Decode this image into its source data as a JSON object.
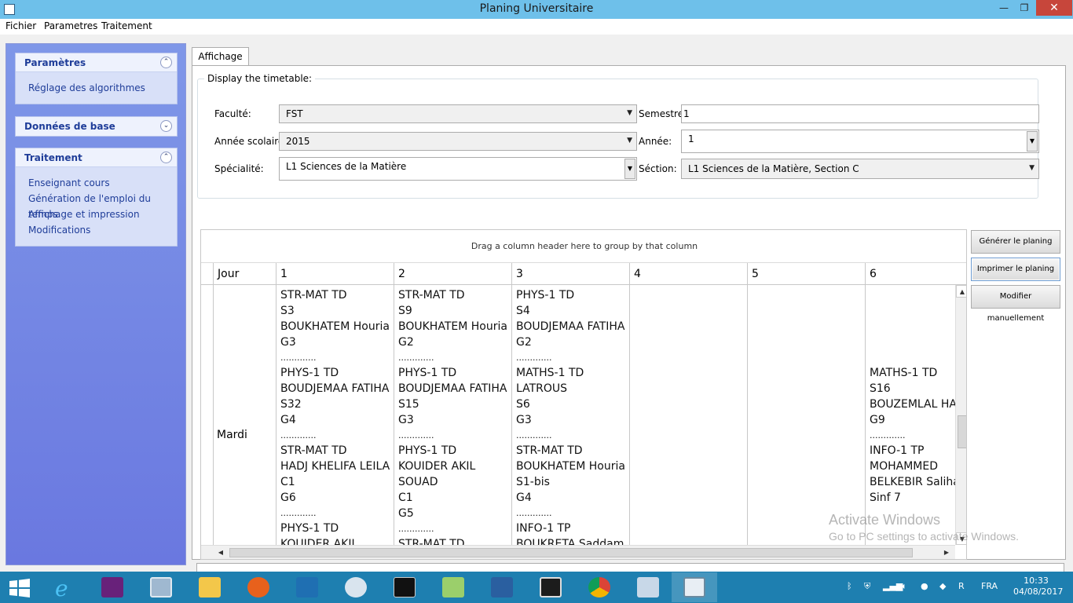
{
  "window": {
    "title": "Planing Universitaire",
    "minimize": "—",
    "maximize": "❐",
    "close": "✕"
  },
  "menu": [
    "Fichier",
    "Parametres",
    "Traitement"
  ],
  "sidebar": {
    "groups": [
      {
        "title": "Paramètres",
        "chevron": "⌃",
        "items": [
          "Réglage des algorithmes"
        ]
      },
      {
        "title": "Données de base",
        "chevron": "⌄",
        "items": []
      },
      {
        "title": "Traitement",
        "chevron": "⌃",
        "items": [
          "Enseignant cours",
          "Génération de l'emploi du temps",
          "Affichage et impression",
          "Modifications"
        ]
      }
    ]
  },
  "tab": {
    "label": "Affichage"
  },
  "form": {
    "legend": "Display the timetable:",
    "faculte": {
      "label": "Faculté:",
      "value": "FST"
    },
    "annee_scolaire": {
      "label": "Année scolaire:",
      "value": "2015"
    },
    "specialite": {
      "label": "Spécialité:",
      "value": "L1 Sciences de la Matière"
    },
    "semestre": {
      "label": "Semestre:",
      "value": "1"
    },
    "annee": {
      "label": "Année:",
      "value": "1"
    },
    "section": {
      "label": "Séction:",
      "value": "L1 Sciences de la Matière, Section C"
    }
  },
  "grid": {
    "group_hint": "Drag a column header here to group by that column",
    "columns": [
      "Jour",
      "1",
      "2",
      "3",
      "4",
      "5",
      "6"
    ],
    "row_day": "Mardi",
    "cells": {
      "c1": [
        "STR-MAT TD",
        "S3",
        "BOUKHATEM Houria",
        "G3",
        ".............",
        "PHYS-1 TD",
        "BOUDJEMAA FATIHA",
        "S32",
        "G4",
        ".............",
        "STR-MAT TD",
        "HADJ KHELIFA LEILA",
        "C1",
        "G6",
        ".............",
        "PHYS-1 TD",
        "KOUIDER AKIL"
      ],
      "c2": [
        "STR-MAT TD",
        "S9",
        "BOUKHATEM Houria",
        "G2",
        ".............",
        "PHYS-1 TD",
        "BOUDJEMAA FATIHA",
        "S15",
        "G3",
        ".............",
        "PHYS-1 TD",
        "KOUIDER AKIL",
        "SOUAD",
        "C1",
        "G5",
        ".............",
        "STR-MAT TD"
      ],
      "c3": [
        "PHYS-1 TD",
        "S4",
        "BOUDJEMAA FATIHA",
        "G2",
        ".............",
        "MATHS-1 TD",
        "LATROUS",
        "S6",
        "G3",
        ".............",
        "STR-MAT TD",
        "BOUKHATEM Houria",
        "S1-bis",
        "G4",
        ".............",
        "INFO-1 TP",
        "BOUKRETA Saddam"
      ],
      "c6": [
        "MATHS-1 TD",
        "S16",
        "BOUZEMLAL HA",
        "G9",
        ".............",
        "INFO-1 TP",
        "MOHAMMED",
        "BELKEBIR Saliha",
        "Sinf 7"
      ]
    }
  },
  "buttons": {
    "generer": "Générer le planing",
    "imprimer": "Imprimer le planing",
    "modifier": "Modifier manuellement"
  },
  "watermark": {
    "line1": "Activate Windows",
    "line2": "Go to PC settings to activate Windows."
  },
  "taskbar": {
    "apps": [
      "windows-logo",
      "internet-explorer",
      "visual-studio",
      "remote-desktop",
      "file-explorer",
      "firefox",
      "visual-studio-code",
      "app-swirl",
      "command-prompt",
      "notepad-plus-plus",
      "powershell",
      "eclipse",
      "chrome",
      "network-tool",
      "planing-app"
    ],
    "lang": "FRA",
    "time": "10:33",
    "date": "04/08/2017"
  },
  "colors": {
    "titlebar": "#6ec0ea",
    "sidebar": "#6a78e0",
    "link": "#1f3d99",
    "taskbar": "#1e7fb0",
    "close": "#c7463b"
  }
}
